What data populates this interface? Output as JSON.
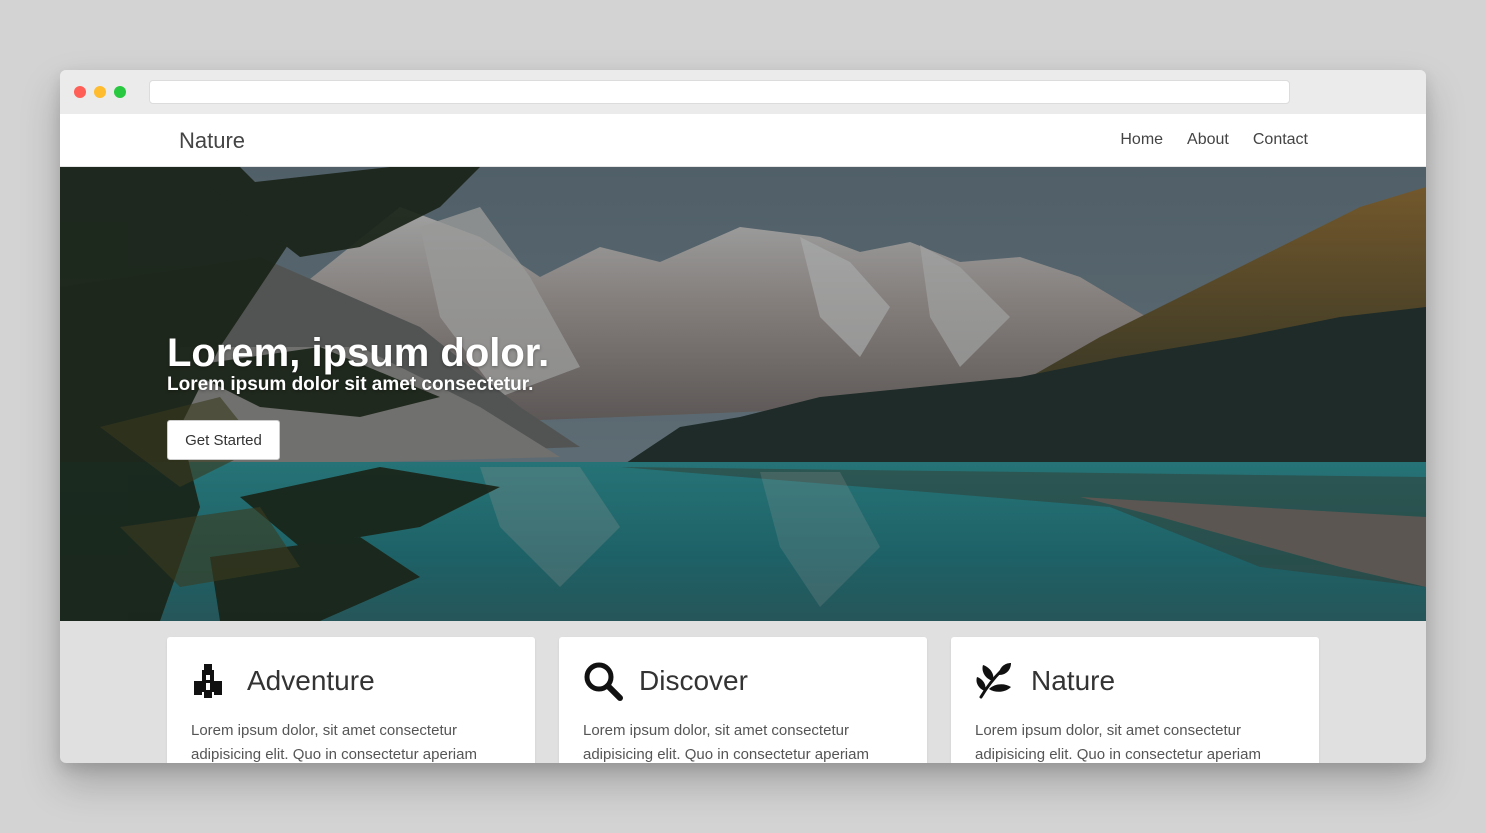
{
  "browser": {
    "url": ""
  },
  "navbar": {
    "brand": "Nature",
    "links": [
      "Home",
      "About",
      "Contact"
    ]
  },
  "hero": {
    "title": "Lorem, ipsum dolor.",
    "subtitle": "Lorem ipsum dolor sit amet consectetur.",
    "button_label": "Get Started",
    "background": "mountain-lake-photo"
  },
  "cards": [
    {
      "icon": "rocket-icon",
      "title": "Adventure",
      "text": "Lorem ipsum dolor, sit amet consectetur adipisicing elit. Quo in consectetur aperiam"
    },
    {
      "icon": "search-icon",
      "title": "Discover",
      "text": "Lorem ipsum dolor, sit amet consectetur adipisicing elit. Quo in consectetur aperiam"
    },
    {
      "icon": "leaf-icon",
      "title": "Nature",
      "text": "Lorem ipsum dolor, sit amet consectetur adipisicing elit. Quo in consectetur aperiam"
    }
  ],
  "colors": {
    "page_bg": "#d3d3d3",
    "window_bg": "#e0e0e0",
    "card_bg": "#ffffff",
    "hero_overlay": "#1f2a30",
    "lake": "#1f8e8f"
  }
}
